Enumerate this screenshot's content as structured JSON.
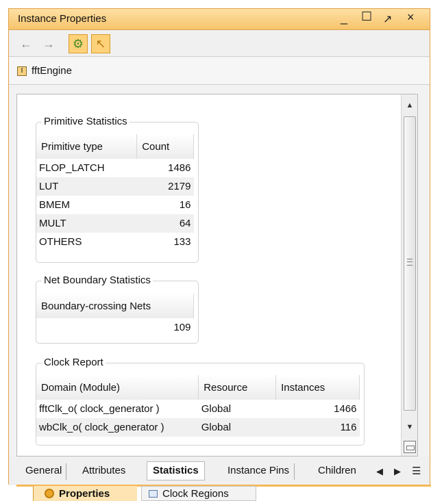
{
  "window": {
    "title": "Instance Properties",
    "controls": {
      "minimize": "_",
      "maximize": "☐",
      "restore": "↗",
      "close": "×"
    }
  },
  "toolbar": {
    "back_icon": "←",
    "forward_icon": "→",
    "gear_icon": "⚙",
    "pointer_icon": "↖"
  },
  "breadcrumb": {
    "icon": "I",
    "text": "fftEngine"
  },
  "primitive_statistics": {
    "legend": "Primitive Statistics",
    "headers": [
      "Primitive type",
      "Count"
    ],
    "rows": [
      {
        "type": "FLOP_LATCH",
        "count": "1486"
      },
      {
        "type": "LUT",
        "count": "2179"
      },
      {
        "type": "BMEM",
        "count": "16"
      },
      {
        "type": "MULT",
        "count": "64"
      },
      {
        "type": "OTHERS",
        "count": "133"
      }
    ]
  },
  "net_boundary_statistics": {
    "legend": "Net Boundary Statistics",
    "header": "Boundary-crossing Nets",
    "value": "109"
  },
  "clock_report": {
    "legend": "Clock Report",
    "headers": [
      "Domain (Module)",
      "Resource",
      "Instances"
    ],
    "rows": [
      {
        "domain": "fftClk_o( clock_generator )",
        "resource": "Global",
        "instances": "1466"
      },
      {
        "domain": "wbClk_o( clock_generator )",
        "resource": "Global",
        "instances": "116"
      }
    ]
  },
  "tabs": [
    {
      "label": "General"
    },
    {
      "label": "Attributes"
    },
    {
      "label": "Statistics",
      "selected": true
    },
    {
      "label": "Instance Pins"
    },
    {
      "label": "Children"
    }
  ],
  "tab_nav": {
    "left_icon": "◀",
    "right_icon": "▶",
    "menu_icon": "☰"
  },
  "view_tabs": {
    "properties": "Properties",
    "clock_regions": "Clock Regions"
  },
  "scrollbar": {
    "up_icon": "▲",
    "down_icon": "▼",
    "position": 0
  }
}
